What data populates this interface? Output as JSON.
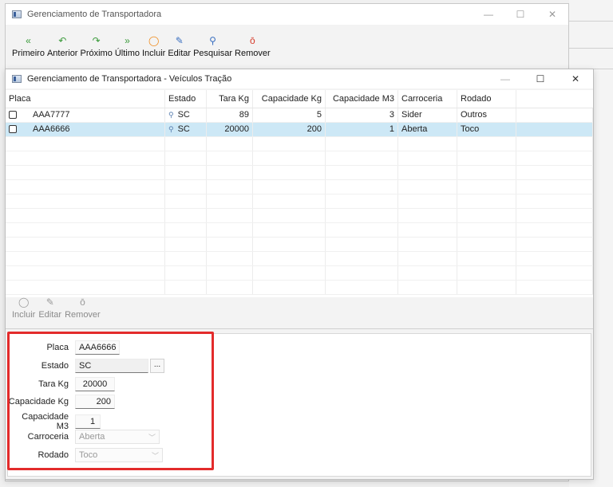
{
  "back_window": {
    "title": "Gerenciamento de Transportadora",
    "toolbar": [
      {
        "label": "Primeiro",
        "icon": "double-chevron-left-icon",
        "glyph": "«",
        "color": "#3a9a3a"
      },
      {
        "label": "Anterior",
        "icon": "undo-arrow-icon",
        "glyph": "↶",
        "color": "#3a9a3a"
      },
      {
        "label": "Próximo",
        "icon": "redo-arrow-icon",
        "glyph": "↷",
        "color": "#3a9a3a"
      },
      {
        "label": "Último",
        "icon": "double-chevron-right-icon",
        "glyph": "»",
        "color": "#3a9a3a"
      },
      {
        "label": "Incluir",
        "icon": "add-circle-icon",
        "glyph": "◯",
        "color": "#f08a1a"
      },
      {
        "label": "Editar",
        "icon": "pin-icon",
        "glyph": "✎",
        "color": "#3a6fc0"
      },
      {
        "label": "Pesquisar",
        "icon": "search-icon",
        "glyph": "⚲",
        "color": "#3a6fc0"
      },
      {
        "label": "Remover",
        "icon": "remove-icon",
        "glyph": "ō",
        "color": "#d63a2a"
      }
    ]
  },
  "front_window": {
    "title": "Gerenciamento de Transportadora - Veículos Tração",
    "grid": {
      "headers": [
        "Placa",
        "Estado",
        "Tara Kg",
        "Capacidade Kg",
        "Capacidade M3",
        "Carroceria",
        "Rodado"
      ],
      "rows": [
        {
          "placa": "AAA7777",
          "estado": "SC",
          "tara": "89",
          "cap_kg": "5",
          "cap_m3": "3",
          "carroceria": "Sider",
          "rodado": "Outros",
          "selected": false
        },
        {
          "placa": "AAA6666",
          "estado": "SC",
          "tara": "20000",
          "cap_kg": "200",
          "cap_m3": "1",
          "carroceria": "Aberta",
          "rodado": "Toco",
          "selected": true
        }
      ]
    },
    "sub_toolbar": [
      {
        "label": "Incluir",
        "icon": "add-circle-icon",
        "glyph": "◯"
      },
      {
        "label": "Editar",
        "icon": "pin-icon",
        "glyph": "✎"
      },
      {
        "label": "Remover",
        "icon": "remove-icon",
        "glyph": "ō"
      }
    ],
    "form": {
      "placa": {
        "label": "Placa",
        "value": "AAA6666"
      },
      "estado": {
        "label": "Estado",
        "value": "SC",
        "button": "..."
      },
      "tara": {
        "label": "Tara Kg",
        "value": "20000"
      },
      "cap_kg": {
        "label": "Capacidade Kg",
        "value": "200"
      },
      "cap_m3": {
        "label": "Capacidade M3",
        "value": "1"
      },
      "carroceria": {
        "label": "Carroceria",
        "value": "Aberta"
      },
      "rodado": {
        "label": "Rodado",
        "value": "Toco"
      }
    }
  },
  "highlight_color": "#e32b2b"
}
